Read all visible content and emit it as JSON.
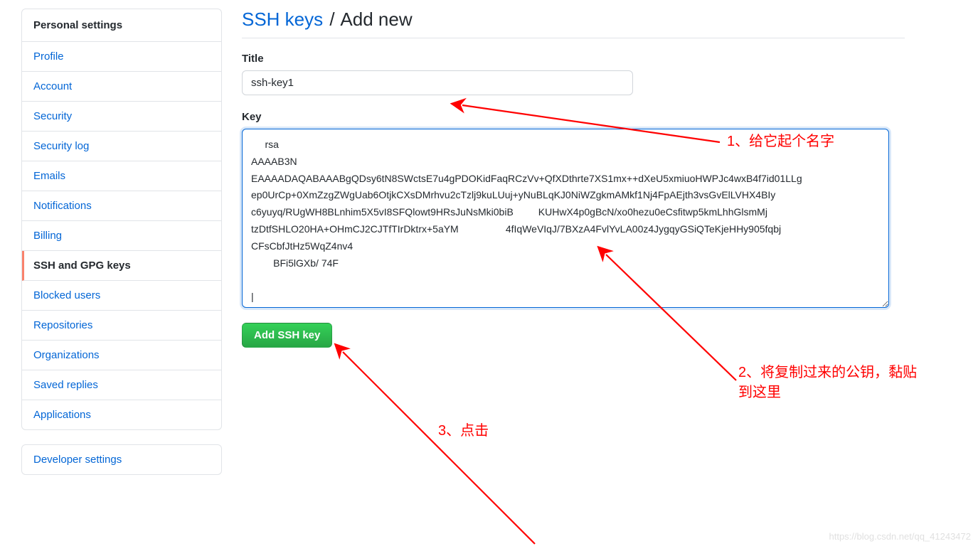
{
  "sidebar": {
    "header": "Personal settings",
    "items": [
      {
        "label": "Profile",
        "active": false
      },
      {
        "label": "Account",
        "active": false
      },
      {
        "label": "Security",
        "active": false
      },
      {
        "label": "Security log",
        "active": false
      },
      {
        "label": "Emails",
        "active": false
      },
      {
        "label": "Notifications",
        "active": false
      },
      {
        "label": "Billing",
        "active": false
      },
      {
        "label": "SSH and GPG keys",
        "active": true
      },
      {
        "label": "Blocked users",
        "active": false
      },
      {
        "label": "Repositories",
        "active": false
      },
      {
        "label": "Organizations",
        "active": false
      },
      {
        "label": "Saved replies",
        "active": false
      },
      {
        "label": "Applications",
        "active": false
      }
    ],
    "footer_item": "Developer settings"
  },
  "page": {
    "heading_link": "SSH keys",
    "heading_sep": "/",
    "heading_tail": "Add new"
  },
  "form": {
    "title_label": "Title",
    "title_value": "ssh-key1",
    "key_label": "Key",
    "key_value": "     rsa\nAAAAB3N             EAAAADAQABAAABgQDsy6tN8SWctsE7u4gPDOKidFaqRCzVv+QfXDthrte7XS1mx++dXeU5xmiuoHWPJc4wxB4f7id01LLg         ep0UrCp+0XmZzgZWgUab6OtjkCXsDMrhvu2cTzlj9kuLUuj+yNuBLqKJ0NiWZgkmAMkf1Nj4FpAEjth3vsGvElLVHX4BIy        c6yuyq/RUgWH8BLnhim5X5vI8SFQlowt9HRsJuNsMki0biB         KUHwX4p0gBcN/xo0hezu0eCsfitwp5kmLhhGlsmMj    tzDtfSHLO20HA+OHmCJ2CJTfTIrDktrx+5aYM                 4fIqWeVIqJ/7BXzA4FvlYvLA00z4JygqyGSiQTeKjeHHy905fqbj      CFsCbfJtHz5WqZ4nv4                                              \n        BFi5lGXb/ 74F\n\n|",
    "submit_label": "Add SSH key"
  },
  "annotations": {
    "a1": "1、给它起个名字",
    "a2": "2、将复制过来的公钥，黏贴到这里",
    "a3": "3、点击"
  },
  "watermark": "https://blog.csdn.net/qq_41243472"
}
